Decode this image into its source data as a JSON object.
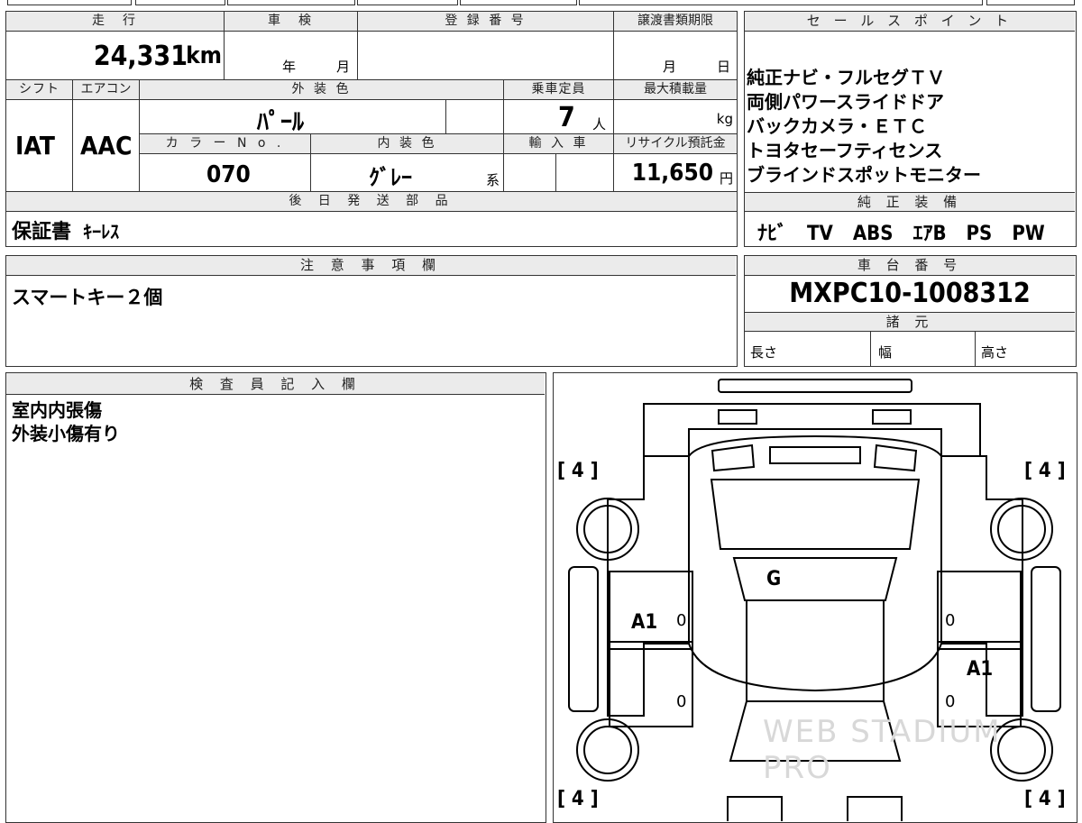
{
  "sheet": {
    "mileage": {
      "label": "走　行",
      "value": "24,331",
      "unit": "km"
    },
    "inspection": {
      "label": "車　検",
      "year_unit": "年",
      "month_unit": "月"
    },
    "registration": {
      "label": "登 録 番 号",
      "value": ""
    },
    "transfer_deadline": {
      "label": "譲渡書類期限",
      "month_unit": "月",
      "day_unit": "日"
    },
    "shift": {
      "label": "シフト",
      "value": "IAT"
    },
    "aircon": {
      "label": "エアコン",
      "value": "AAC"
    },
    "exterior_color": {
      "label": "外 装 色",
      "value": "ﾊﾟｰﾙ"
    },
    "capacity": {
      "label": "乗車定員",
      "value": "7",
      "unit": "人"
    },
    "max_load": {
      "label": "最大積載量",
      "unit": "kg"
    },
    "color_no": {
      "label": "カ ラ ー N o .",
      "value": "070"
    },
    "interior_color": {
      "label": "内 装 色",
      "value": "ｸﾞﾚｰ",
      "suffix": "系"
    },
    "import": {
      "label": "輸 入 車"
    },
    "recycle": {
      "label": "リサイクル預託金",
      "value": "11,650",
      "unit": "円"
    },
    "later_parts": {
      "label": "後 日 発 送 部 品",
      "value_main": "保証書",
      "value_sub": "ｷｰﾚｽ"
    }
  },
  "sales_points": {
    "label": "セ ー ル ス ポ イ ン ト",
    "items": [
      "純正ナビ・フルセグＴＶ",
      "両側パワースライドドア",
      "バックカメラ・ＥＴＣ",
      "トヨタセーフティセンス",
      "ブラインドスポットモニター"
    ]
  },
  "equipment": {
    "label": "純 正 装 備",
    "value": "ﾅﾋﾞ　TV　ABS　ｴｱB　PS　PW"
  },
  "notes": {
    "label": "注 意 事 項 欄",
    "value": "スマートキー２個"
  },
  "chassis": {
    "label": "車 台 番 号",
    "value": "MXPC10-1008312"
  },
  "specs": {
    "label": "諸 元",
    "length": "長さ",
    "width": "幅",
    "height": "高さ"
  },
  "inspector": {
    "label": "検 査 員 記 入 欄",
    "lines": [
      "室内内張傷",
      "外装小傷有り"
    ]
  },
  "diagram": {
    "tire_top_left": "[ 4 ]",
    "tire_top_right": "[ 4 ]",
    "tire_bottom_left": "[ 4 ]",
    "tire_bottom_right": "[ 4 ]",
    "windshield": "G",
    "left_front_door": "A1",
    "right_rear_door": "A1",
    "zero_1": "0",
    "zero_2": "0",
    "zero_3": "0",
    "zero_4": "0",
    "watermark": "WEB STADIUM PRO"
  }
}
